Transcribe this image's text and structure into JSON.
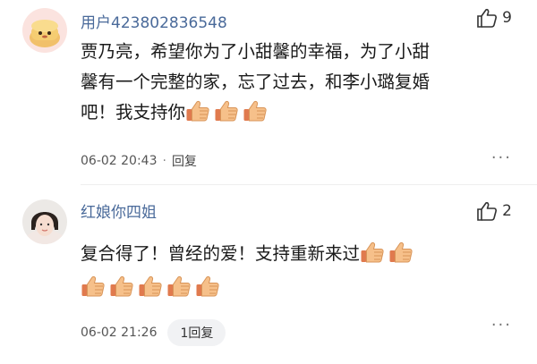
{
  "comments": [
    {
      "username": "用户423802836548",
      "likes": "9",
      "lines": [
        "贾乃亮，希望你为了小甜馨的幸福，为了小甜",
        "馨有一个完整的家，忘了过去，和李小璐复婚",
        "吧！我支持你"
      ],
      "emoji_count": 3,
      "date": "06-02 20:43",
      "reply_label": "回复"
    },
    {
      "username": "红娘你四姐",
      "likes": "2",
      "lines": [
        "复合得了！曾经的爱！支持重新来过"
      ],
      "emoji_count_line1": 2,
      "emoji_count_line2": 5,
      "date": "06-02 21:26",
      "reply_label": "1回复"
    }
  ],
  "more_label": "···",
  "colors": {
    "username": "#4a6a9a",
    "emoji_skin": "#f6c08a",
    "emoji_cuff": "#e07a4e"
  },
  "icons": [
    "thumbs-up-outline-icon",
    "thumbs-up-emoji-icon",
    "more-icon"
  ]
}
